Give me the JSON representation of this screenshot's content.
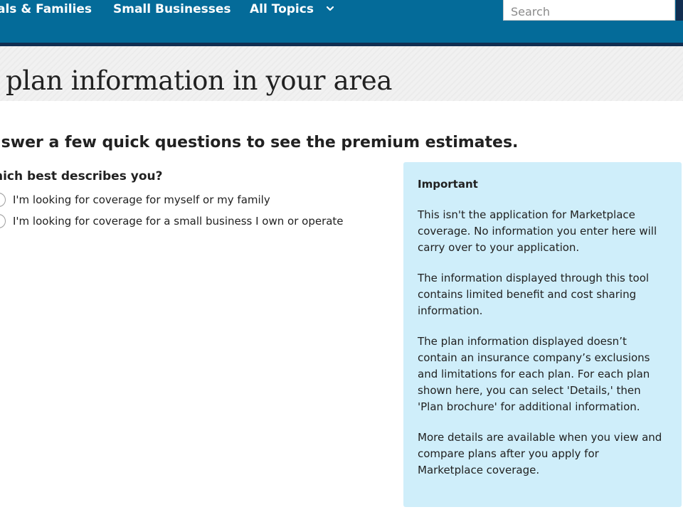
{
  "nav": {
    "links": [
      {
        "label": "als & Families"
      },
      {
        "label": "Small Businesses"
      },
      {
        "label": "All Topics"
      }
    ],
    "topics_chevron": "⌄",
    "search": {
      "placeholder": "Search",
      "value": ""
    },
    "colors": {
      "bar": "#046b99",
      "accent": "#112e51"
    }
  },
  "hero": {
    "title": "t plan information in your area"
  },
  "main": {
    "intro": "nswer a few quick questions to see the premium estimates.",
    "question": "hich best describes you?",
    "options": [
      {
        "label": "I'm looking for coverage for myself or my family",
        "selected": false
      },
      {
        "label": "I'm looking for coverage for a small business I own or operate",
        "selected": false
      }
    ]
  },
  "important": {
    "heading": "Important",
    "paragraphs": [
      "This isn't the application for Marketplace coverage. No information you enter here will carry over to your application.",
      "The information displayed through this tool contains limited benefit and cost sharing information.",
      "The plan information displayed doesn’t contain an insurance company’s exclusions and limitations for each plan. For each plan shown here, you can select 'Details,' then 'Plan brochure' for additional information.",
      "More details are available when you view and compare plans after you apply for Marketplace coverage."
    ],
    "colors": {
      "background": "#cfeefa"
    }
  }
}
